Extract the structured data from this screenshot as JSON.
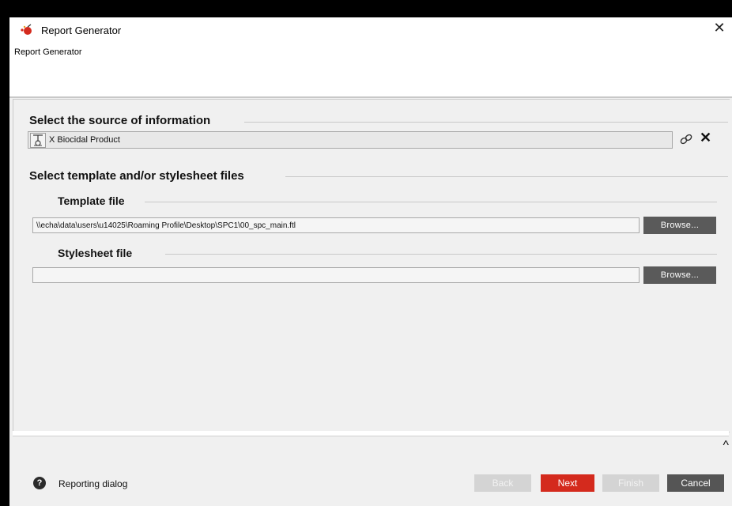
{
  "window": {
    "title": "Report Generator",
    "close_glyph": "✕",
    "app_icon": "report-generator-icon"
  },
  "header": {
    "subtitle": "Report Generator"
  },
  "source_section": {
    "title": "Select the source of information",
    "source_value": "X Biocidal Product",
    "source_icon": "biocidal-product-icon",
    "link_icon": "link-icon",
    "delete_glyph": "✕"
  },
  "template_section": {
    "title": "Select template and/or stylesheet files",
    "template_file": {
      "label": "Template file",
      "value": "\\\\echa\\data\\users\\u14025\\Roaming Profile\\Desktop\\SPC1\\00_spc_main.ftl",
      "browse_label": "Browse..."
    },
    "stylesheet_file": {
      "label": "Stylesheet file",
      "value": "",
      "browse_label": "Browse..."
    }
  },
  "collapse_glyph": "^",
  "footer": {
    "help_glyph": "?",
    "help_text": "Reporting dialog",
    "buttons": {
      "back": "Back",
      "next": "Next",
      "finish": "Finish",
      "cancel": "Cancel"
    }
  },
  "colors": {
    "accent": "#d42a1d",
    "button_dark": "#555555",
    "button_disabled": "#d4d4d4"
  }
}
